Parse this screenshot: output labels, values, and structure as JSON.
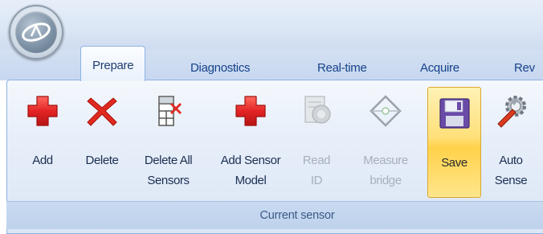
{
  "tabs": [
    {
      "label": "Prepare",
      "active": true
    },
    {
      "label": "Diagnostics"
    },
    {
      "label": "Real-time"
    },
    {
      "label": "Acquire"
    },
    {
      "label": "Rev"
    }
  ],
  "ribbon": {
    "group_caption": "Current sensor",
    "buttons": [
      {
        "line1": "Add",
        "line2": "",
        "icon": "plus-icon",
        "enabled": true
      },
      {
        "line1": "Delete",
        "line2": "",
        "icon": "delete-x-icon",
        "enabled": true
      },
      {
        "line1": "Delete All",
        "line2": "Sensors",
        "icon": "delete-all-grid-icon",
        "enabled": true
      },
      {
        "line1": "Add Sensor",
        "line2": "Model",
        "icon": "plus-icon",
        "enabled": true
      },
      {
        "line1": "Read",
        "line2": "ID",
        "icon": "read-id-icon",
        "enabled": false
      },
      {
        "line1": "Measure",
        "line2": "bridge",
        "icon": "bridge-icon",
        "enabled": false
      },
      {
        "line1": "Save",
        "line2": "",
        "icon": "floppy-disk-icon",
        "enabled": true,
        "highlighted": true
      },
      {
        "line1": "Auto",
        "line2": "Sense",
        "icon": "gear-wrench-icon",
        "enabled": true
      }
    ]
  },
  "colors": {
    "tab_text": "#15428b",
    "ribbon_border": "#8db2e3",
    "save_highlight": "#ffd24a",
    "plus_red": "#e32424"
  }
}
